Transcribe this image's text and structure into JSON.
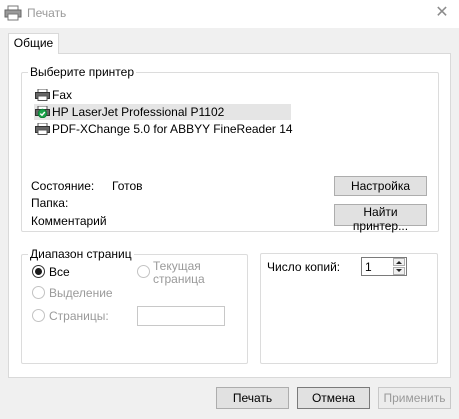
{
  "window": {
    "title": "Печать",
    "close_symbol": "✕"
  },
  "tabs": [
    {
      "label": "Общие",
      "active": true
    }
  ],
  "printer_group": {
    "legend": "Выберите принтер",
    "printers": [
      {
        "name": "Fax",
        "icon": "fax-printer-icon",
        "selected": false,
        "default": false
      },
      {
        "name": "HP LaserJet Professional P1102",
        "icon": "default-printer-check-icon",
        "selected": true,
        "default": true
      },
      {
        "name": "PDF-XChange 5.0 for ABBYY FineReader 14",
        "icon": "printer-icon",
        "selected": false,
        "default": false
      }
    ],
    "status_label": "Состояние:",
    "status_value": "Готов",
    "folder_label": "Папка:",
    "folder_value": "",
    "comment_label": "Комментарий",
    "comment_value": "",
    "settings_button": "Настройка",
    "find_printer_button": "Найти принтер..."
  },
  "page_range": {
    "legend": "Диапазон страниц",
    "all_label": "Все",
    "selection_label": "Выделение",
    "current_page_label_line1": "Текущая",
    "current_page_label_line2": "страница",
    "pages_label": "Страницы:",
    "pages_value": "",
    "selected_option": "all"
  },
  "copies": {
    "label": "Число копий:",
    "value": "1"
  },
  "footer": {
    "print_button": "Печать",
    "cancel_button": "Отмена",
    "apply_button": "Применить"
  },
  "colors": {
    "accent_check": "#1aa34a",
    "disabled_text": "#9a9a9a",
    "selected_row": "#e5e5e5"
  }
}
